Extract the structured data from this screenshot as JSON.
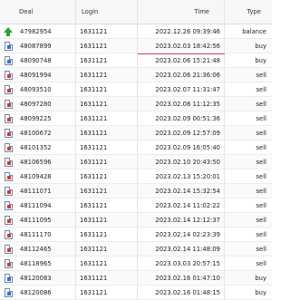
{
  "columns": {
    "deal": "Deal",
    "login": "Login",
    "time": "Time",
    "type": "Type"
  },
  "rows": [
    {
      "deal": "47982954",
      "login": "1631121",
      "time": "2022.12.26 09:39:46",
      "type": "balance",
      "icon": "balance-arrow-icon"
    },
    {
      "deal": "48087899",
      "login": "1631121",
      "time": "2023.02.03 18:42:56",
      "type": "buy",
      "icon": "buy-document-icon"
    },
    {
      "deal": "48090748",
      "login": "1631121",
      "time": "2023.02.06 15:21:48",
      "type": "buy",
      "icon": "buy-document-icon"
    },
    {
      "deal": "48091994",
      "login": "1631121",
      "time": "2023.02.06 21:36:06",
      "type": "sell",
      "icon": "sell-document-icon"
    },
    {
      "deal": "48093510",
      "login": "1631121",
      "time": "2023.02.07 11:31:47",
      "type": "sell",
      "icon": "sell-document-icon"
    },
    {
      "deal": "48097280",
      "login": "1631121",
      "time": "2023.02.08 11:12:35",
      "type": "sell",
      "icon": "sell-document-icon"
    },
    {
      "deal": "48099225",
      "login": "1631121",
      "time": "2023.02.09 00:51:36",
      "type": "sell",
      "icon": "sell-document-icon"
    },
    {
      "deal": "48100672",
      "login": "1631121",
      "time": "2023.02.09 12:57:09",
      "type": "sell",
      "icon": "sell-document-icon"
    },
    {
      "deal": "48101352",
      "login": "1631121",
      "time": "2023.02.09 16:05:40",
      "type": "sell",
      "icon": "sell-document-icon"
    },
    {
      "deal": "48106596",
      "login": "1631121",
      "time": "2023.02.10 20:43:50",
      "type": "sell",
      "icon": "sell-document-icon"
    },
    {
      "deal": "48109428",
      "login": "1631121",
      "time": "2023.02.13 15:20:01",
      "type": "sell",
      "icon": "sell-document-icon"
    },
    {
      "deal": "48111071",
      "login": "1631121",
      "time": "2023.02.14 15:32:54",
      "type": "sell",
      "icon": "sell-document-icon"
    },
    {
      "deal": "48111094",
      "login": "1631121",
      "time": "2023.02.14 11:02:22",
      "type": "sell",
      "icon": "sell-document-icon"
    },
    {
      "deal": "48111095",
      "login": "1631121",
      "time": "2023.02.14 12:12:37",
      "type": "sell",
      "icon": "sell-document-icon"
    },
    {
      "deal": "48111170",
      "login": "1631121",
      "time": "2023.02.14 02:23:39",
      "type": "sell",
      "icon": "sell-document-icon"
    },
    {
      "deal": "48112465",
      "login": "1631121",
      "time": "2023.02.14 11:48:09",
      "type": "sell",
      "icon": "sell-document-icon"
    },
    {
      "deal": "48118965",
      "login": "1631121",
      "time": "2023.03.03 20:57:15",
      "type": "sell",
      "icon": "sell-document-icon"
    },
    {
      "deal": "48120083",
      "login": "1631121",
      "time": "2023.02.16 01:47:10",
      "type": "buy",
      "icon": "buy-document-icon"
    },
    {
      "deal": "48120086",
      "login": "1631121",
      "time": "2023.02.16 01:48:15",
      "type": "buy",
      "icon": "buy-document-icon"
    }
  ],
  "colors": {
    "buy": "#2f6fd6",
    "sell": "#d33a2c",
    "balance": "#2fa12f",
    "selection_underline": "#c04a87"
  },
  "selected_row_index": 1
}
